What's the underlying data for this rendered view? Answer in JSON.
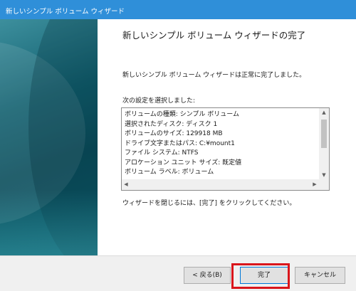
{
  "window": {
    "title": "新しいシンプル ボリューム ウィザード"
  },
  "wizard": {
    "heading": "新しいシンプル ボリューム ウィザードの完了",
    "message": "新しいシンプル ボリューム ウィザードは正常に完了しました。",
    "settings_label": "次の設定を選択しました:",
    "settings": [
      "ボリュームの種類: シンプル ボリューム",
      "選択されたディスク: ディスク 1",
      "ボリュームのサイズ: 129918 MB",
      "ドライブ文字またはパス: C:¥mount1",
      "ファイル システム: NTFS",
      "アロケーション ユニット サイズ: 既定値",
      "ボリューム ラベル: ボリューム"
    ],
    "close_message": "ウィザードを閉じるには、[完了] をクリックしてください。"
  },
  "buttons": {
    "back": "< 戻る(B)",
    "finish": "完了",
    "cancel": "キャンセル"
  },
  "icons": {
    "scroll_up": "▲",
    "scroll_down": "▼",
    "scroll_left": "◀",
    "scroll_right": "▶"
  },
  "colors": {
    "titlebar": "#2f8fd9",
    "highlight": "#d9151b"
  }
}
